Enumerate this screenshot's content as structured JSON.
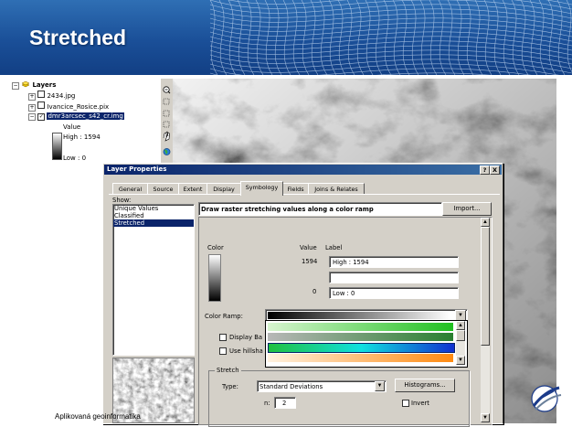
{
  "slide": {
    "title": "Stretched",
    "footer": "Aplikovaná geoinformatika",
    "colors": {
      "header": "#1a4f98",
      "selection": "#0a246a",
      "titlebar": "#0a246a"
    }
  },
  "toc": {
    "root_label": "Layers",
    "layers": [
      {
        "label": "2434.jpg",
        "expanded": false,
        "checked": false
      },
      {
        "label": "Ivancice_Rosice.pix",
        "expanded": false,
        "checked": false
      },
      {
        "label": "dmr3arcsec_s42_cr.img",
        "expanded": true,
        "checked": true,
        "selected": true
      }
    ],
    "legend": {
      "heading": "Value",
      "high": "High : 1594",
      "low": "Low : 0"
    }
  },
  "tools": [
    "zoom-out-icon",
    "full-extent-icon",
    "fixed-zoom-in-icon",
    "fixed-zoom-out-icon",
    "pan-icon",
    "globe-icon"
  ],
  "dialog": {
    "title": "Layer Properties",
    "title_buttons": [
      "?",
      "X"
    ],
    "tabs": [
      "General",
      "Source",
      "Extent",
      "Display",
      "Symbology",
      "Fields",
      "Joins & Relates"
    ],
    "active_tab": "Symbology",
    "show_label": "Show:",
    "show_items": [
      "Unique Values",
      "Classified",
      "Stretched"
    ],
    "show_selected": "Stretched",
    "header_text": "Draw raster stretching values along a color ramp",
    "import_button": "Import...",
    "color_label": "Color",
    "value_label": "Value",
    "label_label": "Label",
    "high_value": "1594",
    "high_label": "High : 1594",
    "middle_label": "",
    "low_value": "0",
    "low_label": "Low : 0",
    "color_ramp_label": "Color Ramp:",
    "display_background_label": "Display Ba",
    "use_hillshade_label": "Use hillsha",
    "ramp_options": [
      "white-to-green",
      "grey-green",
      "green-cyan-blue",
      "white-to-orange"
    ],
    "stretch_group": "Stretch",
    "type_label": "Type:",
    "type_value": "Standard Deviations",
    "histograms_button": "Histograms...",
    "n_label": "n:",
    "n_value": "2",
    "invert_label": "Invert"
  }
}
